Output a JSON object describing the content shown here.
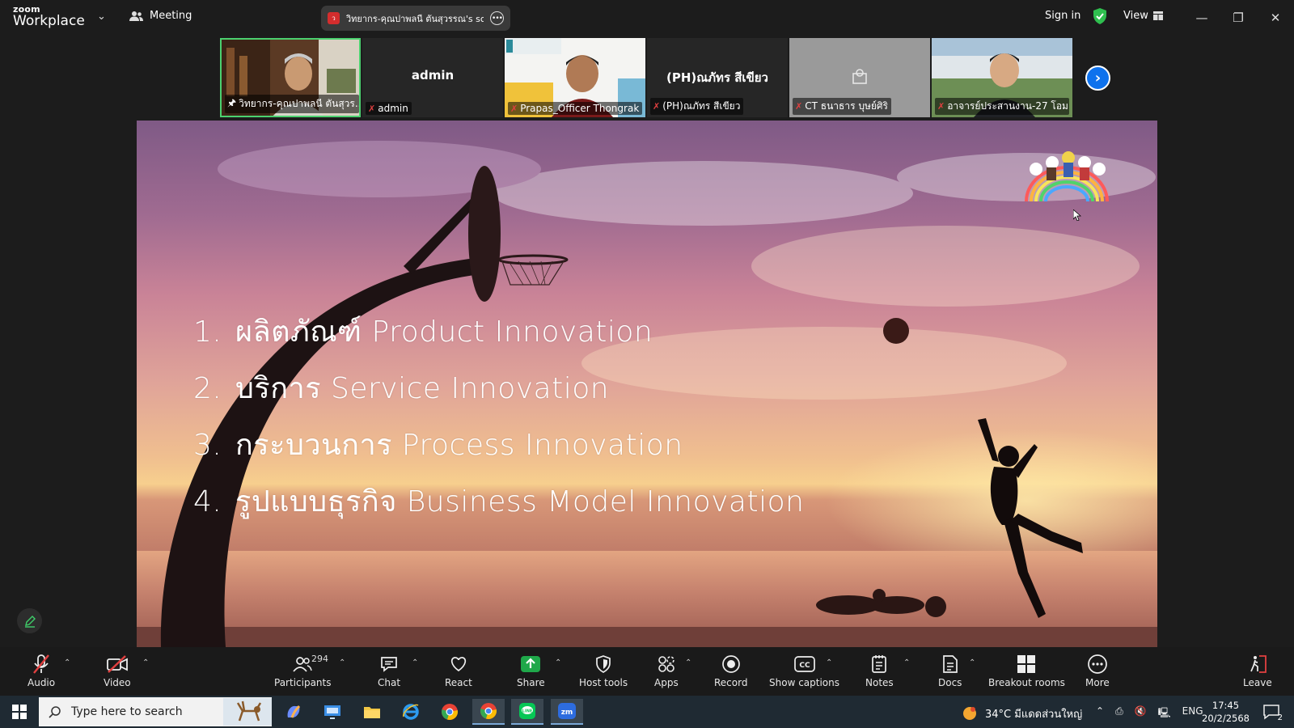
{
  "titlebar": {
    "brand": "zoom",
    "product": "Workplace",
    "meeting_label": "Meeting",
    "share_status": "วิทยากร-คุณปาพลนี ตันสุวรรณ's scre",
    "signin_label": "Sign in",
    "view_label": "View"
  },
  "participants": {
    "tiles": [
      {
        "name": "วิทยากร-คุณปาพลนี ตันสุวร...",
        "kind": "video",
        "pinned": true
      },
      {
        "name": "admin",
        "display": "admin",
        "kind": "name"
      },
      {
        "name": "Prapas_Officer Thongrak",
        "kind": "video"
      },
      {
        "name": "(PH)ณภัทร สีเขียว",
        "display": "(PH)ณภัทร สีเขียว",
        "kind": "name"
      },
      {
        "name": "CT ธนาธาร บุษย์ศิริ",
        "kind": "placeholder"
      },
      {
        "name": "อาจารย์ประสานงาน-27 โอม ...",
        "kind": "video"
      }
    ]
  },
  "slide": {
    "items": [
      {
        "num": "1.",
        "text": "ผลิตภัณฑ์ Product Innovation"
      },
      {
        "num": "2.",
        "text": "บริการ Service Innovation"
      },
      {
        "num": "3.",
        "text": "กระบวนการ Process Innovation"
      },
      {
        "num": "4.",
        "text": "รูปแบบธุรกิจ Business Model Innovation"
      }
    ]
  },
  "toolbar": {
    "audio": "Audio",
    "video": "Video",
    "participants": "Participants",
    "participant_count": "294",
    "chat": "Chat",
    "react": "React",
    "share": "Share",
    "host_tools": "Host tools",
    "apps": "Apps",
    "record": "Record",
    "captions": "Show captions",
    "notes": "Notes",
    "docs": "Docs",
    "breakout": "Breakout rooms",
    "more": "More",
    "leave": "Leave"
  },
  "taskbar": {
    "search_placeholder": "Type here to search",
    "weather": "34°C  มีแดดส่วนใหญ่",
    "lang": "ENG",
    "time": "17:45",
    "date": "20/2/2568",
    "notif_count": "2"
  },
  "colors": {
    "accent_blue": "#0e72ed",
    "share_green": "#1fa84a",
    "active_border": "#4bd16f",
    "muted_red": "#e04040"
  }
}
